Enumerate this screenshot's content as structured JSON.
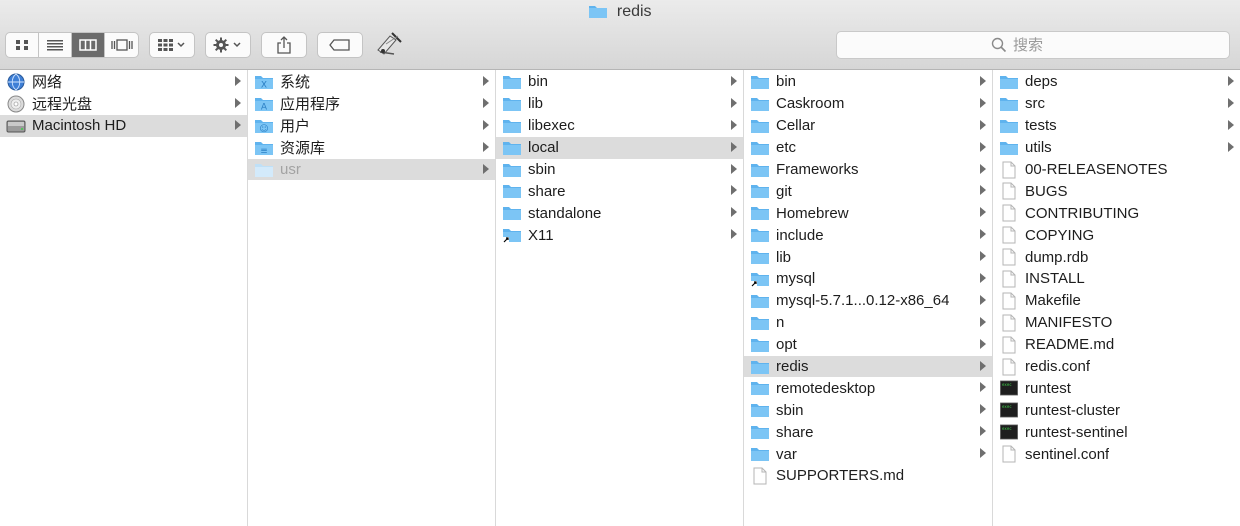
{
  "window": {
    "title": "redis"
  },
  "toolbar": {
    "view_buttons": [
      "icon-view-icon",
      "list-view-icon",
      "column-view-icon",
      "gallery-view-icon"
    ],
    "search_placeholder": "搜索"
  },
  "colors": {
    "folder": "#5fb3ee",
    "selection": "#dcdcdc",
    "dim_text": "#a3a3a3"
  },
  "columns": [
    {
      "items": [
        {
          "label": "网络",
          "icon": "network-globe-icon",
          "arrow": true
        },
        {
          "label": "远程光盘",
          "icon": "optical-disc-icon",
          "arrow": true
        },
        {
          "label": "Macintosh HD",
          "icon": "hard-drive-icon",
          "arrow": true,
          "selected": true
        }
      ]
    },
    {
      "items": [
        {
          "label": "系统",
          "icon": "system-folder-icon",
          "arrow": true
        },
        {
          "label": "应用程序",
          "icon": "applications-folder-icon",
          "arrow": true
        },
        {
          "label": "用户",
          "icon": "users-folder-icon",
          "arrow": true
        },
        {
          "label": "资源库",
          "icon": "library-folder-icon",
          "arrow": true
        },
        {
          "label": "usr",
          "icon": "folder-icon",
          "arrow": true,
          "selected": true,
          "dim": true
        }
      ]
    },
    {
      "items": [
        {
          "label": "bin",
          "icon": "folder-icon",
          "arrow": true
        },
        {
          "label": "lib",
          "icon": "folder-icon",
          "arrow": true
        },
        {
          "label": "libexec",
          "icon": "folder-icon",
          "arrow": true
        },
        {
          "label": "local",
          "icon": "folder-icon",
          "arrow": true,
          "selected": true
        },
        {
          "label": "sbin",
          "icon": "folder-icon",
          "arrow": true
        },
        {
          "label": "share",
          "icon": "folder-icon",
          "arrow": true
        },
        {
          "label": "standalone",
          "icon": "folder-icon",
          "arrow": true
        },
        {
          "label": "X11",
          "icon": "folder-alias-icon",
          "arrow": true
        }
      ]
    },
    {
      "items": [
        {
          "label": "bin",
          "icon": "folder-icon",
          "arrow": true
        },
        {
          "label": "Caskroom",
          "icon": "folder-icon",
          "arrow": true
        },
        {
          "label": "Cellar",
          "icon": "folder-icon",
          "arrow": true
        },
        {
          "label": "etc",
          "icon": "folder-icon",
          "arrow": true
        },
        {
          "label": "Frameworks",
          "icon": "folder-icon",
          "arrow": true
        },
        {
          "label": "git",
          "icon": "folder-icon",
          "arrow": true
        },
        {
          "label": "Homebrew",
          "icon": "folder-icon",
          "arrow": true
        },
        {
          "label": "include",
          "icon": "folder-icon",
          "arrow": true
        },
        {
          "label": "lib",
          "icon": "folder-icon",
          "arrow": true
        },
        {
          "label": "mysql",
          "icon": "folder-alias-icon",
          "arrow": true
        },
        {
          "label": "mysql-5.7.1...0.12-x86_64",
          "icon": "folder-icon",
          "arrow": true
        },
        {
          "label": "n",
          "icon": "folder-icon",
          "arrow": true
        },
        {
          "label": "opt",
          "icon": "folder-icon",
          "arrow": true
        },
        {
          "label": "redis",
          "icon": "folder-icon",
          "arrow": true,
          "selected": true
        },
        {
          "label": "remotedesktop",
          "icon": "folder-icon",
          "arrow": true
        },
        {
          "label": "sbin",
          "icon": "folder-icon",
          "arrow": true
        },
        {
          "label": "share",
          "icon": "folder-icon",
          "arrow": true
        },
        {
          "label": "var",
          "icon": "folder-icon",
          "arrow": true
        },
        {
          "label": "SUPPORTERS.md",
          "icon": "document-icon",
          "arrow": false
        }
      ]
    },
    {
      "items": [
        {
          "label": "deps",
          "icon": "folder-icon",
          "arrow": true
        },
        {
          "label": "src",
          "icon": "folder-icon",
          "arrow": true
        },
        {
          "label": "tests",
          "icon": "folder-icon",
          "arrow": true
        },
        {
          "label": "utils",
          "icon": "folder-icon",
          "arrow": true
        },
        {
          "label": "00-RELEASENOTES",
          "icon": "document-icon",
          "arrow": false
        },
        {
          "label": "BUGS",
          "icon": "document-icon",
          "arrow": false
        },
        {
          "label": "CONTRIBUTING",
          "icon": "document-icon",
          "arrow": false
        },
        {
          "label": "COPYING",
          "icon": "document-icon",
          "arrow": false
        },
        {
          "label": "dump.rdb",
          "icon": "document-icon",
          "arrow": false
        },
        {
          "label": "INSTALL",
          "icon": "document-icon",
          "arrow": false
        },
        {
          "label": "Makefile",
          "icon": "document-icon",
          "arrow": false
        },
        {
          "label": "MANIFESTO",
          "icon": "document-icon",
          "arrow": false
        },
        {
          "label": "README.md",
          "icon": "document-icon",
          "arrow": false
        },
        {
          "label": "redis.conf",
          "icon": "document-icon",
          "arrow": false
        },
        {
          "label": "runtest",
          "icon": "terminal-exec-icon",
          "arrow": false
        },
        {
          "label": "runtest-cluster",
          "icon": "terminal-exec-icon",
          "arrow": false
        },
        {
          "label": "runtest-sentinel",
          "icon": "terminal-exec-icon",
          "arrow": false
        },
        {
          "label": "sentinel.conf",
          "icon": "document-icon",
          "arrow": false
        }
      ]
    }
  ]
}
